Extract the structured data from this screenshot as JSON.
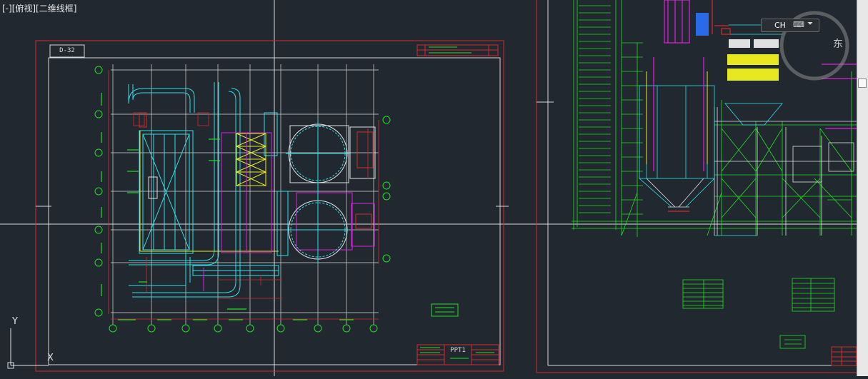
{
  "viewport": {
    "view_label": "[-][俯视][二维线框]",
    "frame_tag": "D-32",
    "title_block_text": "PPT1"
  },
  "viewcube": {
    "east_label": "东"
  },
  "ime": {
    "label": "CH",
    "keyboard_icon": "keyboard-icon",
    "menu_icon": "chevron-down-icon"
  },
  "ucs": {
    "x_label": "X",
    "y_label": "Y"
  },
  "colors": {
    "background": "#212830",
    "red": "#d22b2b",
    "green": "#20e020",
    "cyan": "#30e0e8",
    "magenta": "#e020e0",
    "yellow": "#e8e820",
    "white": "#e0e0e0",
    "blue": "#2a6ae8"
  }
}
